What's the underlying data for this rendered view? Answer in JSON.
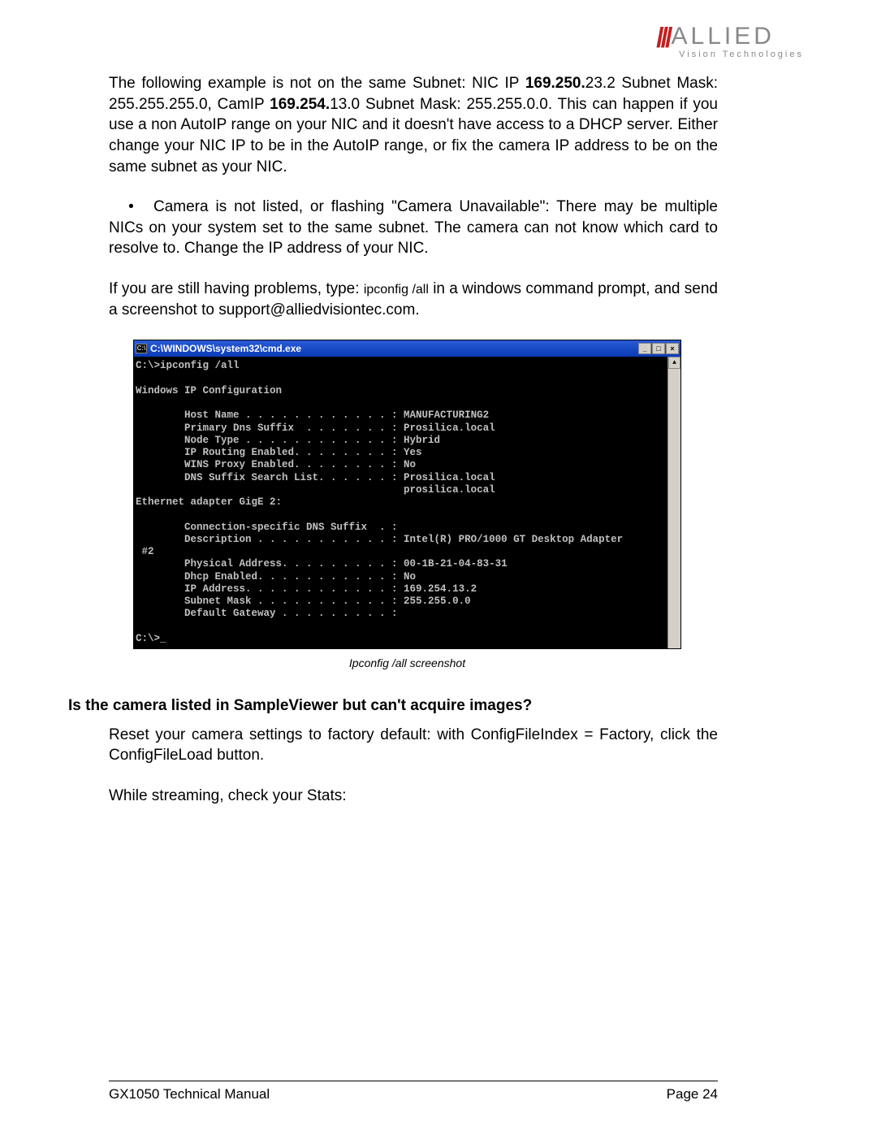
{
  "logo": {
    "slashes": "///",
    "main": "ALLIED",
    "sub": "Vision Technologies"
  },
  "para1": {
    "pre": "The following example is not on the same Subnet: NIC IP ",
    "bold1": "169.250.",
    "mid1": "23.2 Subnet Mask: 255.255.255.0, CamIP ",
    "bold2": "169.254.",
    "mid2": "13.0 Subnet Mask: 255.255.0.0. This can happen if you use a non AutoIP range on your NIC and it doesn't have access to a DHCP server. Either change your NIC IP to be in the AutoIP range, or fix the camera IP address to be on the same subnet as your NIC."
  },
  "para2": {
    "bullet": "•",
    "text": "Camera is not listed, or flashing \"Camera Unavailable\": There may be multiple NICs on your system set to the same subnet. The camera can not know which card to resolve to. Change the IP address of your NIC."
  },
  "para3": {
    "pre": "If you are still having problems, type:  ",
    "cmd": "ipconfig /all",
    "post": " in a windows command prompt, and send a screenshot to support@alliedvisiontec.com."
  },
  "cmd": {
    "title": "C:\\WINDOWS\\system32\\cmd.exe",
    "icon": "C:\\",
    "min": "_",
    "max": "□",
    "close": "×",
    "up": "▲",
    "body": "C:\\>ipconfig /all\n\nWindows IP Configuration\n\n        Host Name . . . . . . . . . . . . : MANUFACTURING2\n        Primary Dns Suffix  . . . . . . . : Prosilica.local\n        Node Type . . . . . . . . . . . . : Hybrid\n        IP Routing Enabled. . . . . . . . : Yes\n        WINS Proxy Enabled. . . . . . . . : No\n        DNS Suffix Search List. . . . . . : Prosilica.local\n                                            prosilica.local\nEthernet adapter GigE 2:\n\n        Connection-specific DNS Suffix  . :\n        Description . . . . . . . . . . . : Intel(R) PRO/1000 GT Desktop Adapter\n #2\n        Physical Address. . . . . . . . . : 00-1B-21-04-83-31\n        Dhcp Enabled. . . . . . . . . . . : No\n        IP Address. . . . . . . . . . . . : 169.254.13.2\n        Subnet Mask . . . . . . . . . . . : 255.255.0.0\n        Default Gateway . . . . . . . . . :\n\nC:\\>_"
  },
  "caption": "Ipconfig /all screenshot",
  "heading": "Is the camera listed in SampleViewer but can't acquire images?",
  "para4": "Reset your camera settings to factory default: with ConfigFileIndex = Factory, click the ConfigFileLoad button.",
  "para5": "While streaming, check your Stats:",
  "footer": {
    "left": "GX1050 Technical Manual",
    "right": "Page 24"
  }
}
